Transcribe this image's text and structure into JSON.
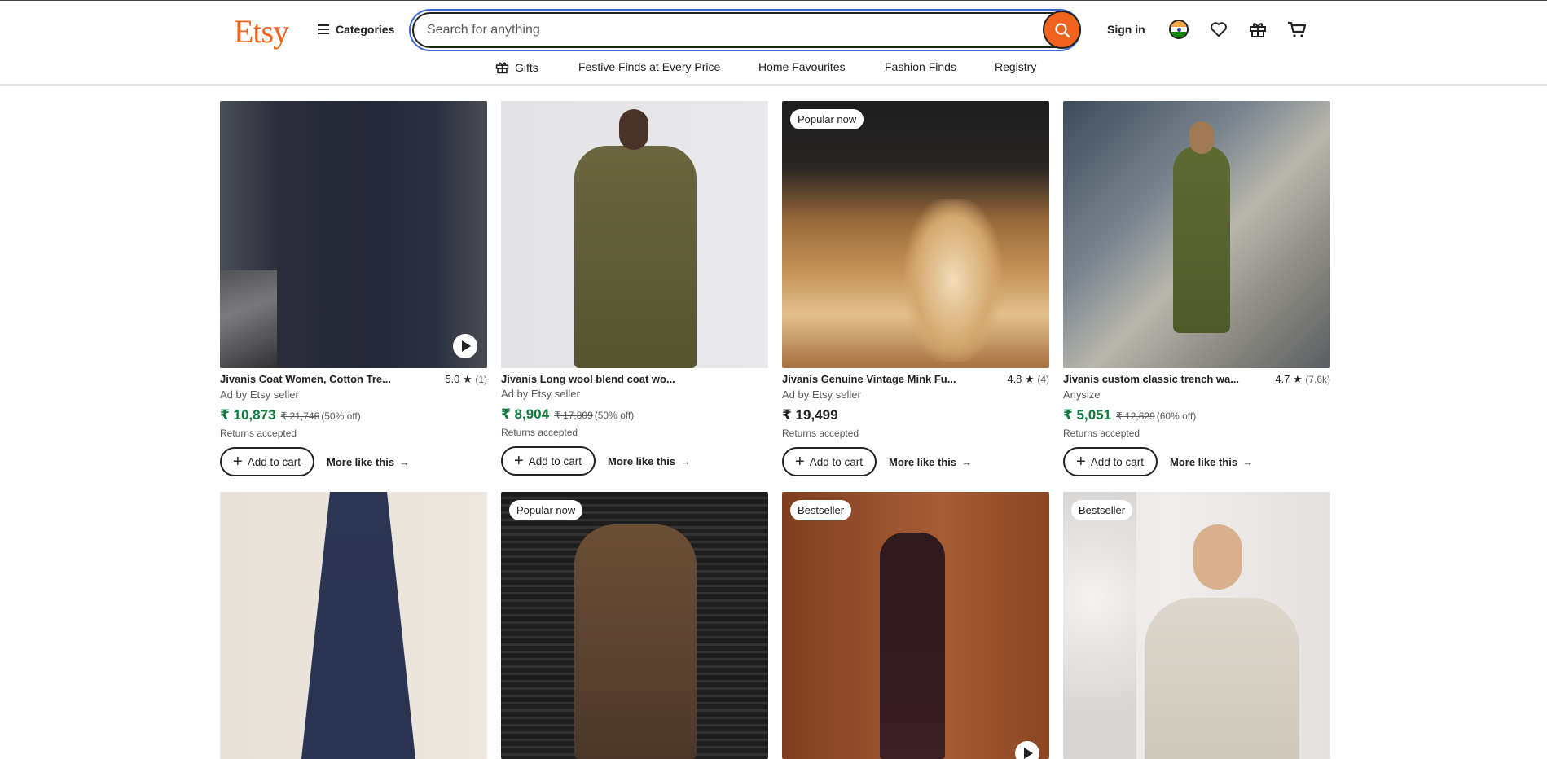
{
  "header": {
    "logo": "Etsy",
    "categories_label": "Categories",
    "search_placeholder": "Search for anything",
    "search_value": "",
    "signin_label": "Sign in",
    "icons": [
      "india-flag-icon",
      "heart-icon",
      "gift-icon",
      "cart-icon"
    ],
    "accent_color": "#f1641e"
  },
  "subnav": {
    "items": [
      {
        "label": "Gifts",
        "icon": "gift-icon"
      },
      {
        "label": "Festive Finds at Every Price"
      },
      {
        "label": "Home Favourites"
      },
      {
        "label": "Fashion Finds"
      },
      {
        "label": "Registry"
      }
    ]
  },
  "listings": [
    {
      "title": "Jivanis Coat Women, Cotton Tre...",
      "rating": "5.0",
      "reviews": "(1)",
      "seller": "Ad by Etsy seller",
      "price": "₹ 10,873",
      "original_price": "₹ 21,746",
      "discount": "(50% off)",
      "returns": "Returns accepted",
      "add_label": "Add to cart",
      "more_label": "More like this",
      "badge": "",
      "has_video": true
    },
    {
      "title": "Jivanis Long wool blend coat wo...",
      "rating": "",
      "reviews": "",
      "seller": "Ad by Etsy seller",
      "price": "₹ 8,904",
      "original_price": "₹ 17,809",
      "discount": "(50% off)",
      "returns": "Returns accepted",
      "add_label": "Add to cart",
      "more_label": "More like this",
      "badge": "",
      "has_video": false
    },
    {
      "title": "Jivanis Genuine Vintage Mink Fu...",
      "rating": "4.8",
      "reviews": "(4)",
      "seller": "Ad by Etsy seller",
      "price": "₹ 19,499",
      "original_price": "",
      "discount": "",
      "returns": "Returns accepted",
      "add_label": "Add to cart",
      "more_label": "More like this",
      "badge": "Popular now",
      "has_video": false
    },
    {
      "title": "Jivanis custom classic trench wa...",
      "rating": "4.7",
      "reviews": "(7.6k)",
      "seller": "Anysize",
      "price": "₹ 5,051",
      "original_price": "₹ 12,629",
      "discount": "(60% off)",
      "returns": "Returns accepted",
      "add_label": "Add to cart",
      "more_label": "More like this",
      "badge": "",
      "has_video": false
    },
    {
      "badge": "",
      "has_video": false
    },
    {
      "badge": "Popular now",
      "has_video": false
    },
    {
      "badge": "Bestseller",
      "has_video": true
    },
    {
      "badge": "Bestseller",
      "has_video": false
    }
  ]
}
